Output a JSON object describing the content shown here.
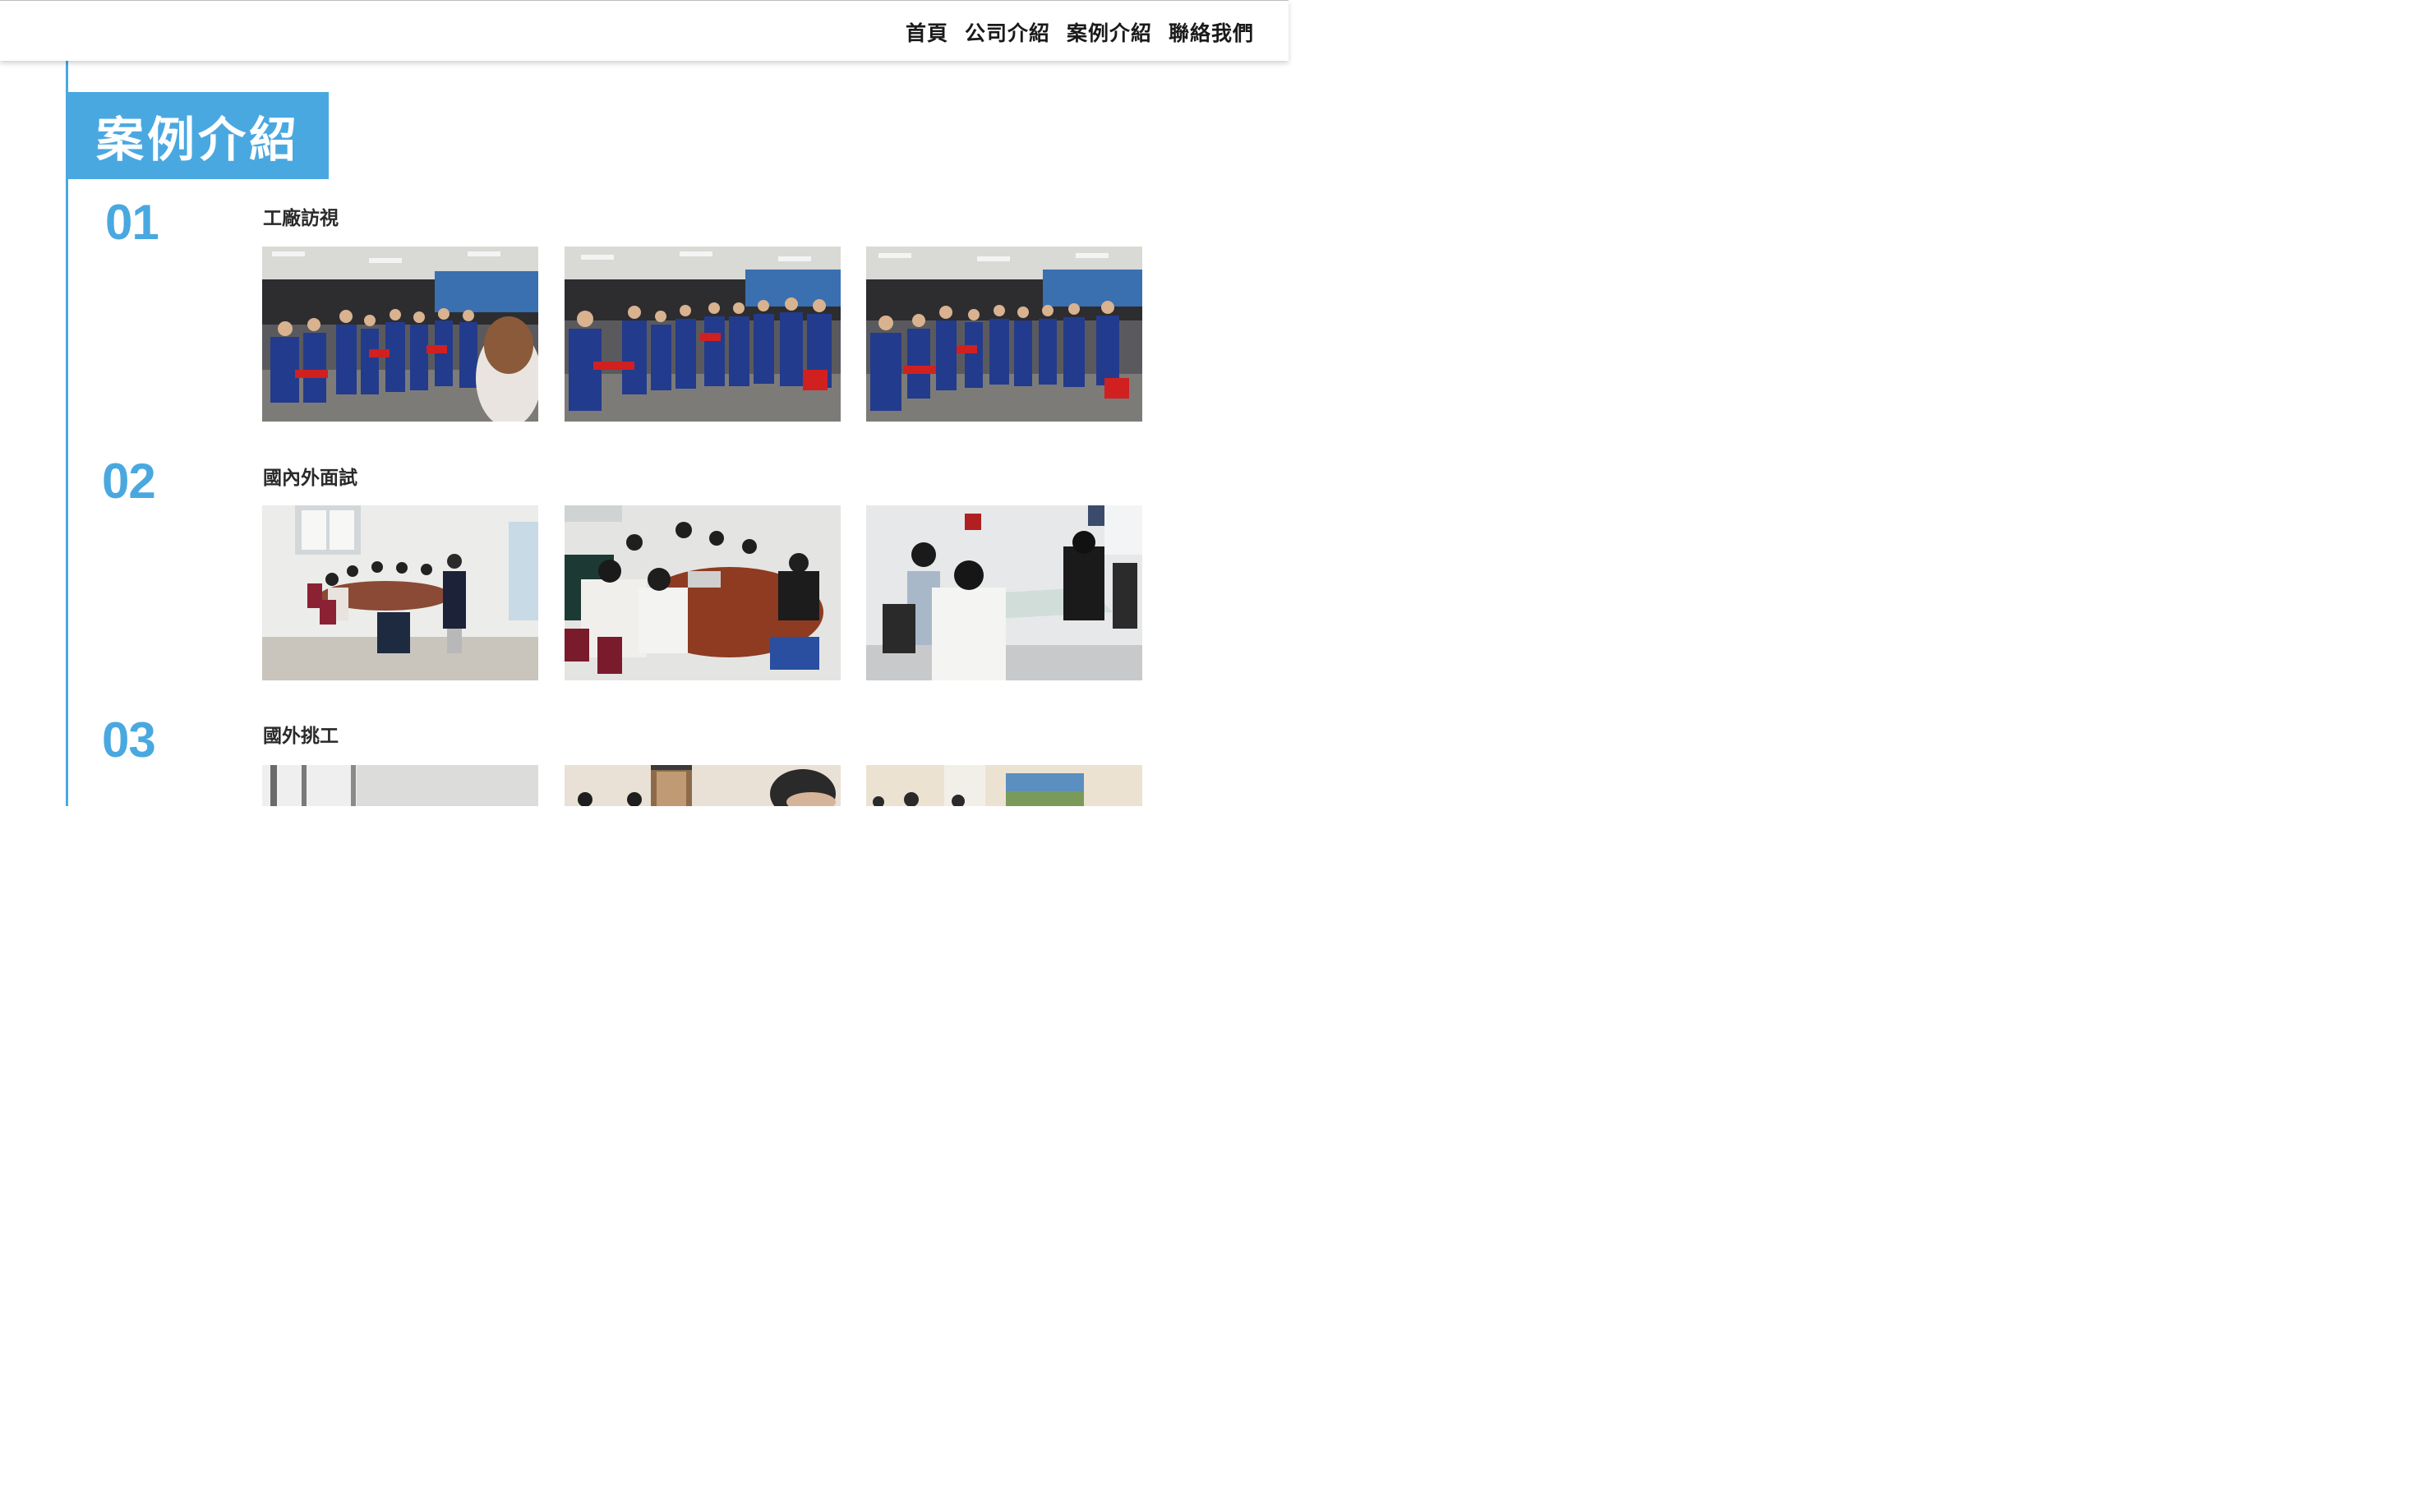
{
  "nav": {
    "items": [
      "首頁",
      "公司介紹",
      "案例介紹",
      "聯絡我們"
    ]
  },
  "page_title": "案例介紹",
  "sections": [
    {
      "number": "01",
      "title": "工廠訪視"
    },
    {
      "number": "02",
      "title": "國內外面試"
    },
    {
      "number": "03",
      "title": "國外挑工"
    }
  ],
  "colors": {
    "accent": "#4aa8e0",
    "nav_text": "#1a1a1a"
  },
  "icons": {
    "photos": "photo-thumbnail"
  }
}
